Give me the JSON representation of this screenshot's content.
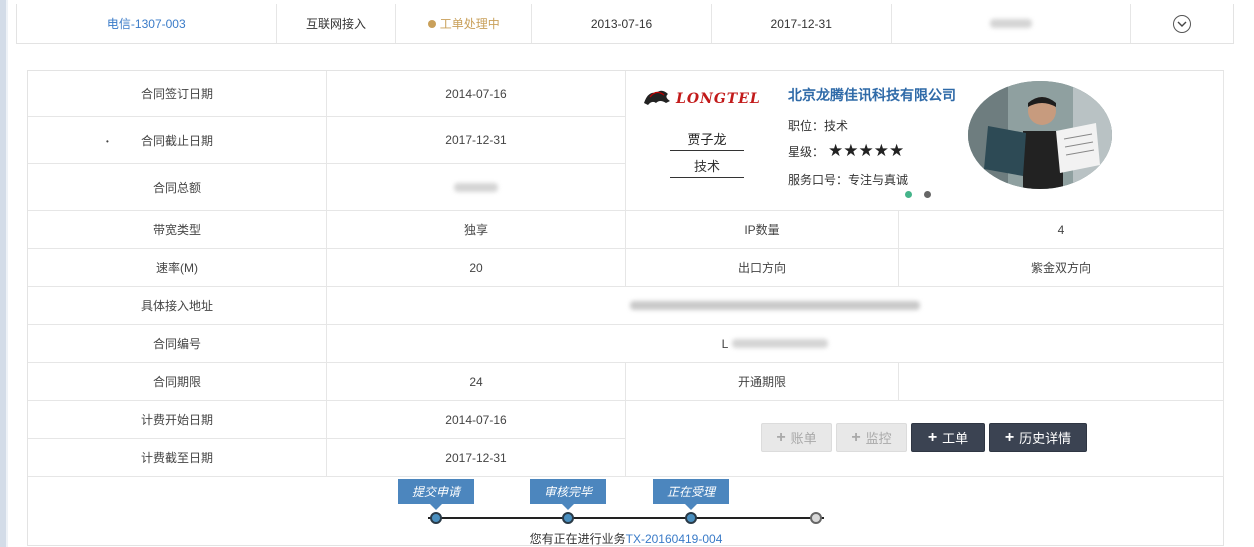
{
  "summary": {
    "id": "电信-1307-003",
    "type": "互联网接入",
    "status": "工单处理中",
    "start_date": "2013-07-16",
    "end_date": "2017-12-31"
  },
  "contract": {
    "sign_label": "合同签订日期",
    "sign_value": "2014-07-16",
    "end_label": "合同截止日期",
    "end_value": "2017-12-31",
    "total_label": "合同总额",
    "bandwidth_label": "带宽类型",
    "bandwidth_value": "独享",
    "ip_label": "IP数量",
    "ip_value": "4",
    "rate_label": "速率(M)",
    "rate_value": "20",
    "exit_label": "出口方向",
    "exit_value": "紫金双方向",
    "address_label": "具体接入地址",
    "number_label": "合同编号",
    "number_prefix": "L",
    "term_label": "合同期限",
    "term_value": "24",
    "open_label": "开通期限",
    "billing_start_label": "计费开始日期",
    "billing_start_value": "2014-07-16",
    "billing_end_label": "计费截至日期",
    "billing_end_value": "2017-12-31"
  },
  "staff": {
    "logo_text": "LONGTEL",
    "company": "北京龙腾佳讯科技有限公司",
    "name": "贾子龙",
    "role": "技术",
    "position": "职位：技术",
    "rating_label": "星级：",
    "rating": 5,
    "stars": "★★★★★",
    "slogan": "服务口号：专注与真诚"
  },
  "actions": {
    "bill": "账单",
    "monitor": "监控",
    "ticket": "工单",
    "history": "历史详情"
  },
  "progress": {
    "steps": [
      "提交申请",
      "审核完毕",
      "正在受理"
    ],
    "note_prefix": "您有正在进行业务",
    "note_id": "TX-20160419-004"
  },
  "colors": {
    "link": "#3a7bc8",
    "status": "#c9a05a",
    "tag": "#4c86be",
    "dark_button": "#3b4352"
  }
}
